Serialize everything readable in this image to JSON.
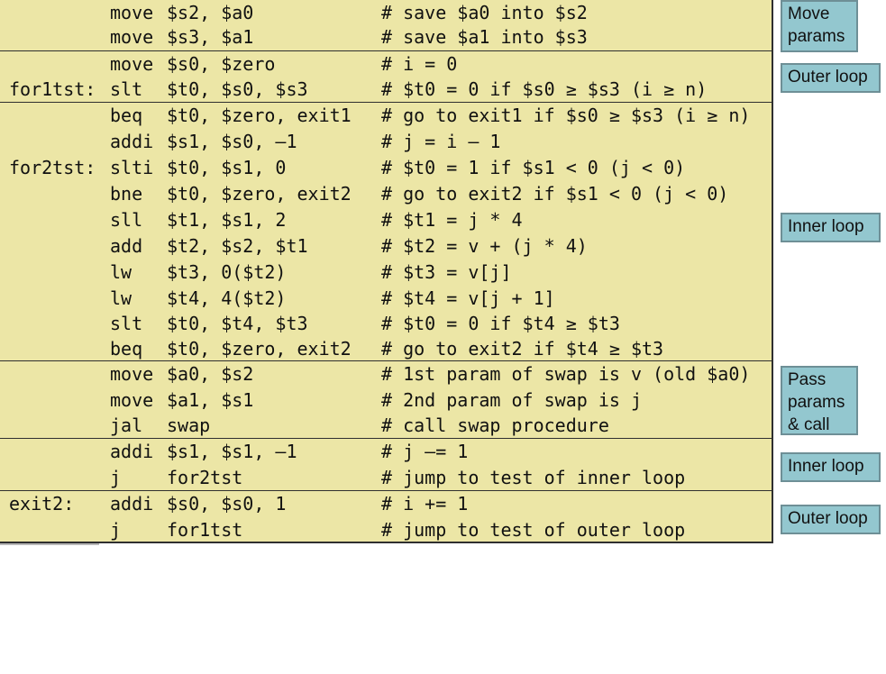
{
  "code": {
    "lines": [
      {
        "label": "",
        "op": "move",
        "args": "$s2, $a0",
        "comment": "# save $a0 into $s2"
      },
      {
        "label": "",
        "op": "move",
        "args": "$s3, $a1",
        "comment": "# save $a1 into $s3"
      },
      {
        "label": "",
        "op": "move",
        "args": "$s0, $zero",
        "comment": "# i = 0"
      },
      {
        "label": "for1tst:",
        "op": "slt",
        "args": "$t0, $s0, $s3",
        "comment": "# $t0 = 0 if $s0 ≥ $s3 (i ≥ n)"
      },
      {
        "label": "",
        "op": "beq",
        "args": "$t0, $zero, exit1",
        "comment": "# go to exit1 if $s0 ≥ $s3 (i ≥ n)"
      },
      {
        "label": "",
        "op": "addi",
        "args": "$s1, $s0, –1",
        "comment": "# j = i – 1"
      },
      {
        "label": "for2tst:",
        "op": "slti",
        "args": "$t0, $s1, 0",
        "comment": "# $t0 = 1 if $s1 < 0 (j < 0)"
      },
      {
        "label": "",
        "op": "bne",
        "args": "$t0, $zero, exit2",
        "comment": "# go to exit2 if $s1 < 0 (j < 0)"
      },
      {
        "label": "",
        "op": "sll",
        "args": "$t1, $s1, 2",
        "comment": "# $t1 = j * 4"
      },
      {
        "label": "",
        "op": "add",
        "args": "$t2, $s2, $t1",
        "comment": "# $t2 = v + (j * 4)"
      },
      {
        "label": "",
        "op": "lw",
        "args": "$t3, 0($t2)",
        "comment": "# $t3 = v[j]"
      },
      {
        "label": "",
        "op": "lw",
        "args": "$t4, 4($t2)",
        "comment": "# $t4 = v[j + 1]"
      },
      {
        "label": "",
        "op": "slt",
        "args": "$t0, $t4, $t3",
        "comment": "# $t0 = 0 if $t4 ≥ $t3"
      },
      {
        "label": "",
        "op": "beq",
        "args": "$t0, $zero, exit2",
        "comment": "# go to exit2 if $t4 ≥ $t3"
      },
      {
        "label": "",
        "op": "move",
        "args": "$a0, $s2",
        "comment": "# 1st param of swap is v (old $a0)"
      },
      {
        "label": "",
        "op": "move",
        "args": "$a1, $s1",
        "comment": "# 2nd param of swap is j"
      },
      {
        "label": "",
        "op": "jal",
        "args": "swap",
        "comment": "# call swap procedure"
      },
      {
        "label": "",
        "op": "addi",
        "args": "$s1, $s1, –1",
        "comment": "# j –= 1"
      },
      {
        "label": "",
        "op": "j",
        "args": "for2tst",
        "comment": "# jump to test of inner loop"
      },
      {
        "label": "exit2:",
        "op": "addi",
        "args": "$s0, $s0, 1",
        "comment": "# i += 1"
      },
      {
        "label": "",
        "op": "j",
        "args": "for1tst",
        "comment": "# jump to test of outer loop"
      }
    ]
  },
  "notes": [
    {
      "text": "Move\nparams"
    },
    {
      "text": "Outer loop"
    },
    {
      "text": "Inner loop"
    },
    {
      "text": "Pass\nparams\n& call"
    },
    {
      "text": "Inner loop"
    },
    {
      "text": "Outer loop"
    }
  ],
  "colors": {
    "code_background": "#ece6a6",
    "note_background": "#93c7cf",
    "border": "#2f2f2f"
  }
}
